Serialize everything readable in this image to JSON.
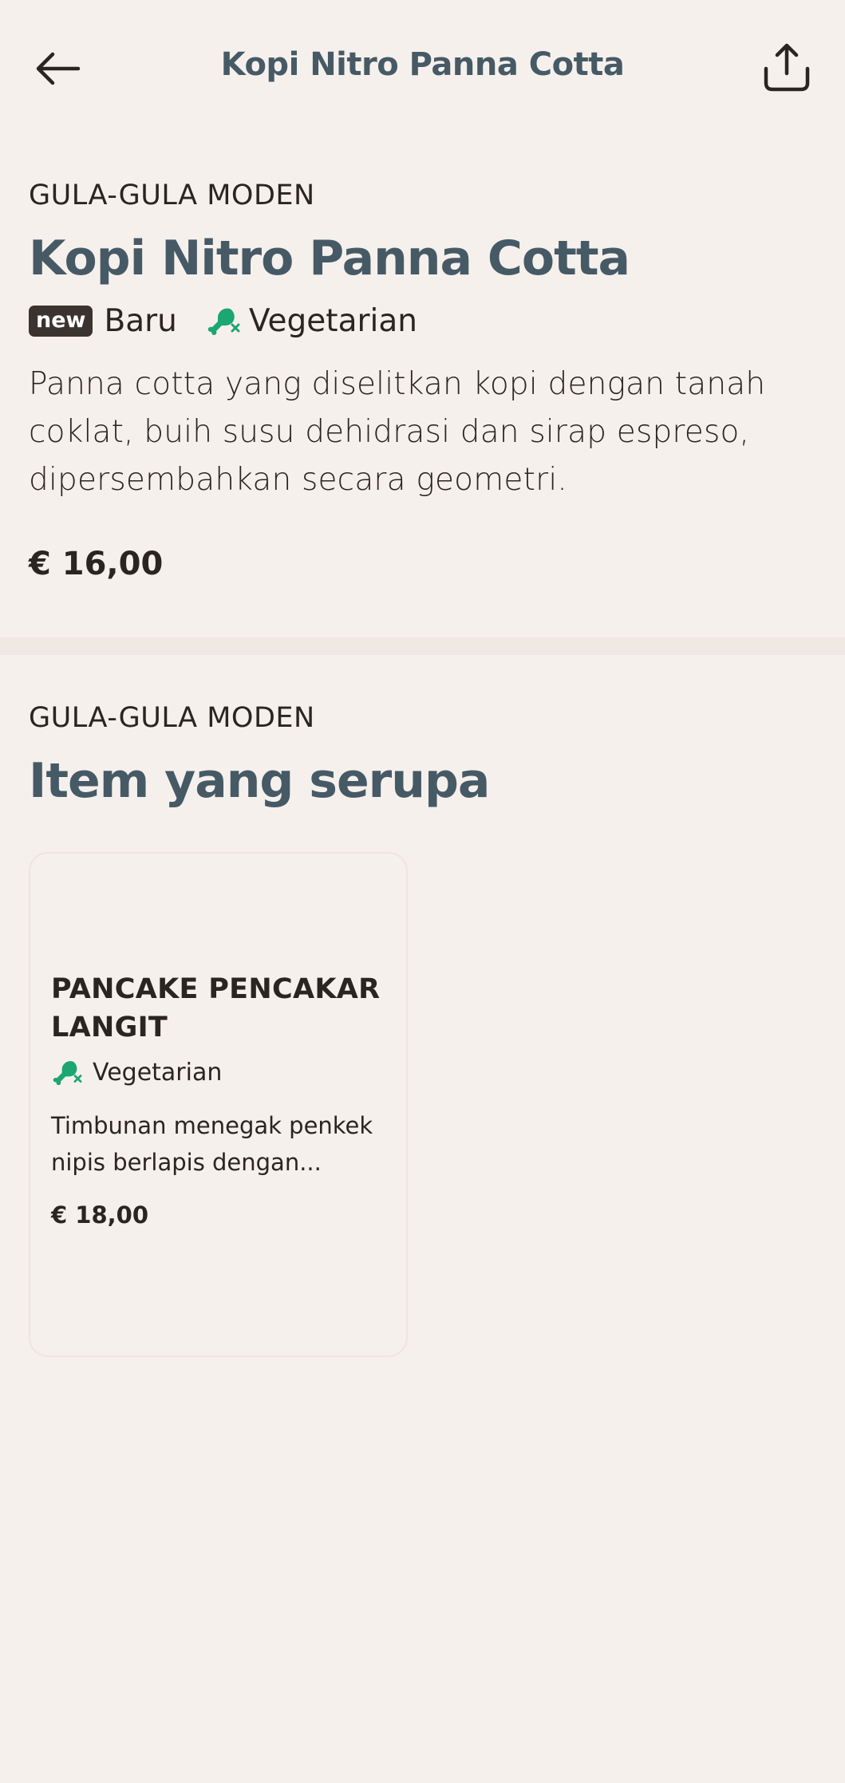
{
  "header": {
    "title": "Kopi Nitro Panna Cotta",
    "back_icon": "arrow-left-icon",
    "share_icon": "share-icon"
  },
  "item": {
    "category": "GULA-GULA MODEN",
    "title": "Kopi Nitro Panna Cotta",
    "new_badge": "new",
    "new_label": "Baru",
    "veg_label": "Vegetarian",
    "description": "Panna cotta yang diselitkan kopi dengan tanah coklat, buih susu dehidrasi dan sirap espreso, dipersembahkan secara geometri.",
    "price": "€ 16,00"
  },
  "similar": {
    "category": "GULA-GULA MODEN",
    "title": "Item yang serupa",
    "cards": [
      {
        "title": "PANCAKE PENCAKAR LANGIT",
        "veg_label": "Vegetarian",
        "description": "Timbunan menegak penkek nipis berlapis dengan...",
        "price": "€ 18,00"
      }
    ]
  },
  "colors": {
    "background": "#F6F0EC",
    "title_blue": "#465A66",
    "text": "#2B2522",
    "veg_green": "#1BA672",
    "badge_bg": "#3A3330"
  }
}
